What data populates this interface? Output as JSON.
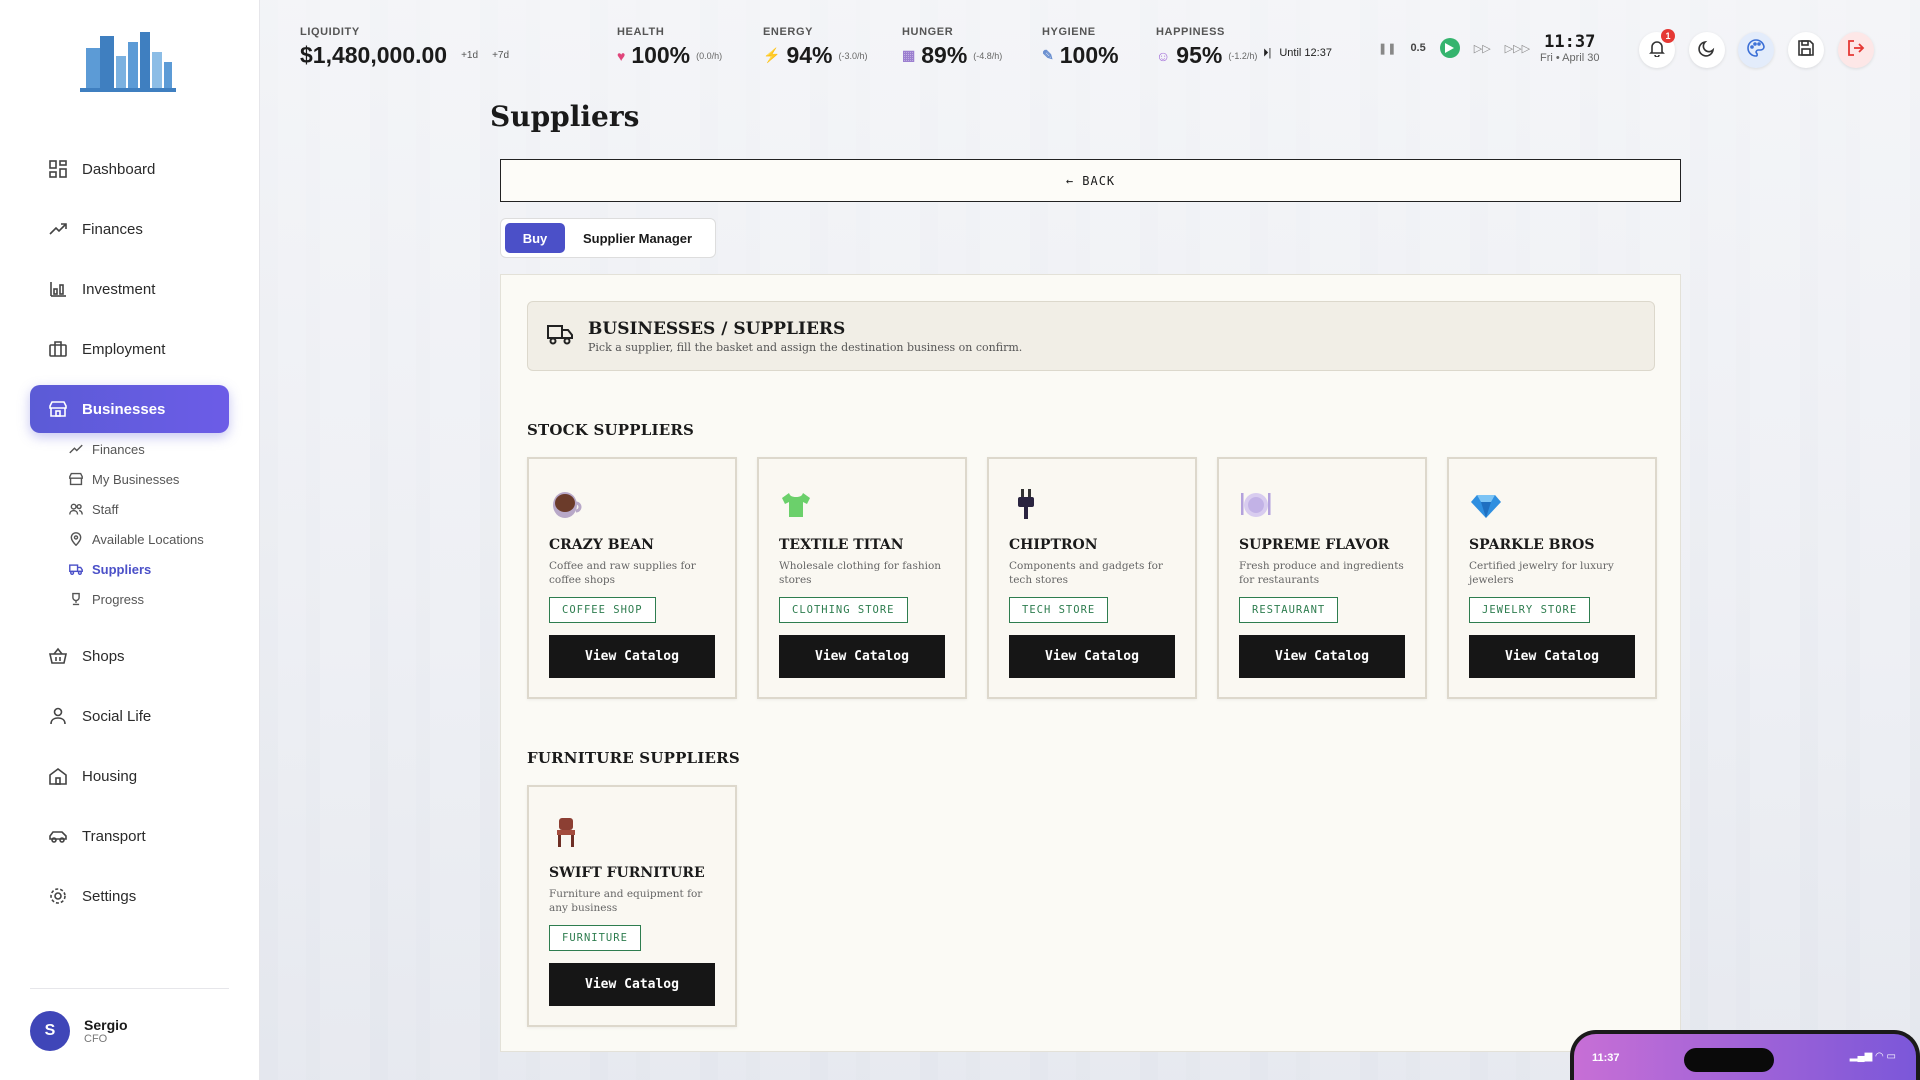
{
  "sidebar": {
    "items_top": [
      {
        "label": "Dashboard",
        "icon": "dashboard-icon"
      },
      {
        "label": "Finances",
        "icon": "trending-up-icon"
      },
      {
        "label": "Investment",
        "icon": "chart-icon"
      },
      {
        "label": "Employment",
        "icon": "briefcase-icon"
      },
      {
        "label": "Businesses",
        "icon": "store-icon",
        "active": true
      }
    ],
    "sub_items": [
      {
        "label": "Finances",
        "icon": "trending-up-icon"
      },
      {
        "label": "My Businesses",
        "icon": "store-icon"
      },
      {
        "label": "Staff",
        "icon": "people-icon"
      },
      {
        "label": "Available Locations",
        "icon": "location-icon"
      },
      {
        "label": "Suppliers",
        "icon": "truck-icon",
        "active": true
      },
      {
        "label": "Progress",
        "icon": "trophy-icon"
      }
    ],
    "items_bottom": [
      {
        "label": "Shops",
        "icon": "basket-icon"
      },
      {
        "label": "Social Life",
        "icon": "person-icon"
      },
      {
        "label": "Housing",
        "icon": "home-icon"
      },
      {
        "label": "Transport",
        "icon": "car-icon"
      },
      {
        "label": "Settings",
        "icon": "gear-icon"
      }
    ],
    "user": {
      "initial": "S",
      "name": "Sergio",
      "role": "CFO"
    }
  },
  "topbar": {
    "liquidity": {
      "label": "LIQUIDITY",
      "value": "$1,480,000.00",
      "chip1": "+1d",
      "chip2": "+7d"
    },
    "health": {
      "label": "HEALTH",
      "value": "100%",
      "delta": "(0.0/h)"
    },
    "energy": {
      "label": "ENERGY",
      "value": "94%",
      "delta": "(-3.0/h)"
    },
    "hunger": {
      "label": "HUNGER",
      "value": "89%",
      "delta": "(-4.8/h)"
    },
    "hygiene": {
      "label": "HYGIENE",
      "value": "100%"
    },
    "happiness": {
      "label": "HAPPINESS",
      "value": "95%",
      "delta": "(-1.2/h)"
    },
    "until": "Until 12:37",
    "speed": "0.5",
    "time": "11:37",
    "date": "Fri • April 30",
    "notifications": "1"
  },
  "page": {
    "title": "Suppliers",
    "back_label": "← BACK",
    "tabs": [
      "Buy",
      "Supplier Manager"
    ],
    "header_title": "BUSINESSES / SUPPLIERS",
    "header_sub": "Pick a supplier, fill the basket and assign the destination business on confirm.",
    "stock_section": "STOCK SUPPLIERS",
    "furniture_section": "FURNITURE SUPPLIERS",
    "button_label": "View Catalog"
  },
  "stock_suppliers": [
    {
      "name": "CRAZY BEAN",
      "desc": "Coffee and raw supplies for coffee shops",
      "tag": "COFFEE SHOP",
      "icon": "coffee-icon"
    },
    {
      "name": "TEXTILE TITAN",
      "desc": "Wholesale clothing for fashion stores",
      "tag": "CLOTHING STORE",
      "icon": "tshirt-icon"
    },
    {
      "name": "CHIPTRON",
      "desc": "Components and gadgets for tech stores",
      "tag": "TECH STORE",
      "icon": "plug-icon"
    },
    {
      "name": "SUPREME FLAVOR",
      "desc": "Fresh produce and ingredients for restaurants",
      "tag": "RESTAURANT",
      "icon": "plate-icon"
    },
    {
      "name": "SPARKLE BROS",
      "desc": "Certified jewelry for luxury jewelers",
      "tag": "JEWELRY STORE",
      "icon": "diamond-icon"
    }
  ],
  "furniture_suppliers": [
    {
      "name": "SWIFT FURNITURE",
      "desc": "Furniture and equipment for any business",
      "tag": "FURNITURE",
      "icon": "chair-icon"
    }
  ],
  "phone": {
    "time": "11:37"
  },
  "colors": {
    "accent": "#4b50c8",
    "tag_green": "#2e7d4f",
    "button_dark": "#161616"
  }
}
